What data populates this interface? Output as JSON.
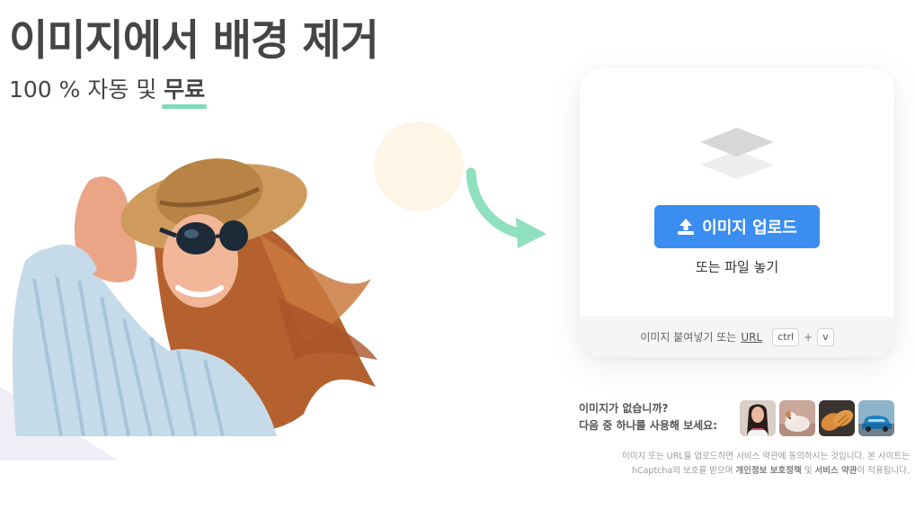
{
  "hero": {
    "title": "이미지에서 배경 제거",
    "subtitle_prefix": "100 % 자동 및 ",
    "subtitle_highlight": "무료"
  },
  "upload": {
    "button_label": "이미지 업로드",
    "drop_text": "또는 파일 놓기",
    "paste_text": "이미지 붙여넣기 또는",
    "url_label": "URL",
    "key_ctrl": "ctrl",
    "key_plus": "+",
    "key_v": "v"
  },
  "samples": {
    "line1": "이미지가 없습니까?",
    "line2": "다음 중 하나를 사용해 보세요:",
    "thumbnails": [
      "woman-portrait-thumb",
      "dog-thumb",
      "bread-thumb",
      "car-thumb"
    ]
  },
  "legal": {
    "line1": "이미지 또는 URL을 업로드하면 서비스 약관에 동의하시는 것입니다. 본 사이트는",
    "line2_a": "hCaptcha의 보호를 받으며 ",
    "line2_privacy": "개인정보 보호정책",
    "line2_b": " 및 ",
    "line2_terms": "서비스 약관",
    "line2_c": "이 적용됩니다."
  },
  "colors": {
    "accent_blue": "#3b8ef0",
    "highlight_green": "#7fdcb6",
    "arrow_green": "#8fe0be",
    "circle_cream": "#fdf6e6"
  }
}
